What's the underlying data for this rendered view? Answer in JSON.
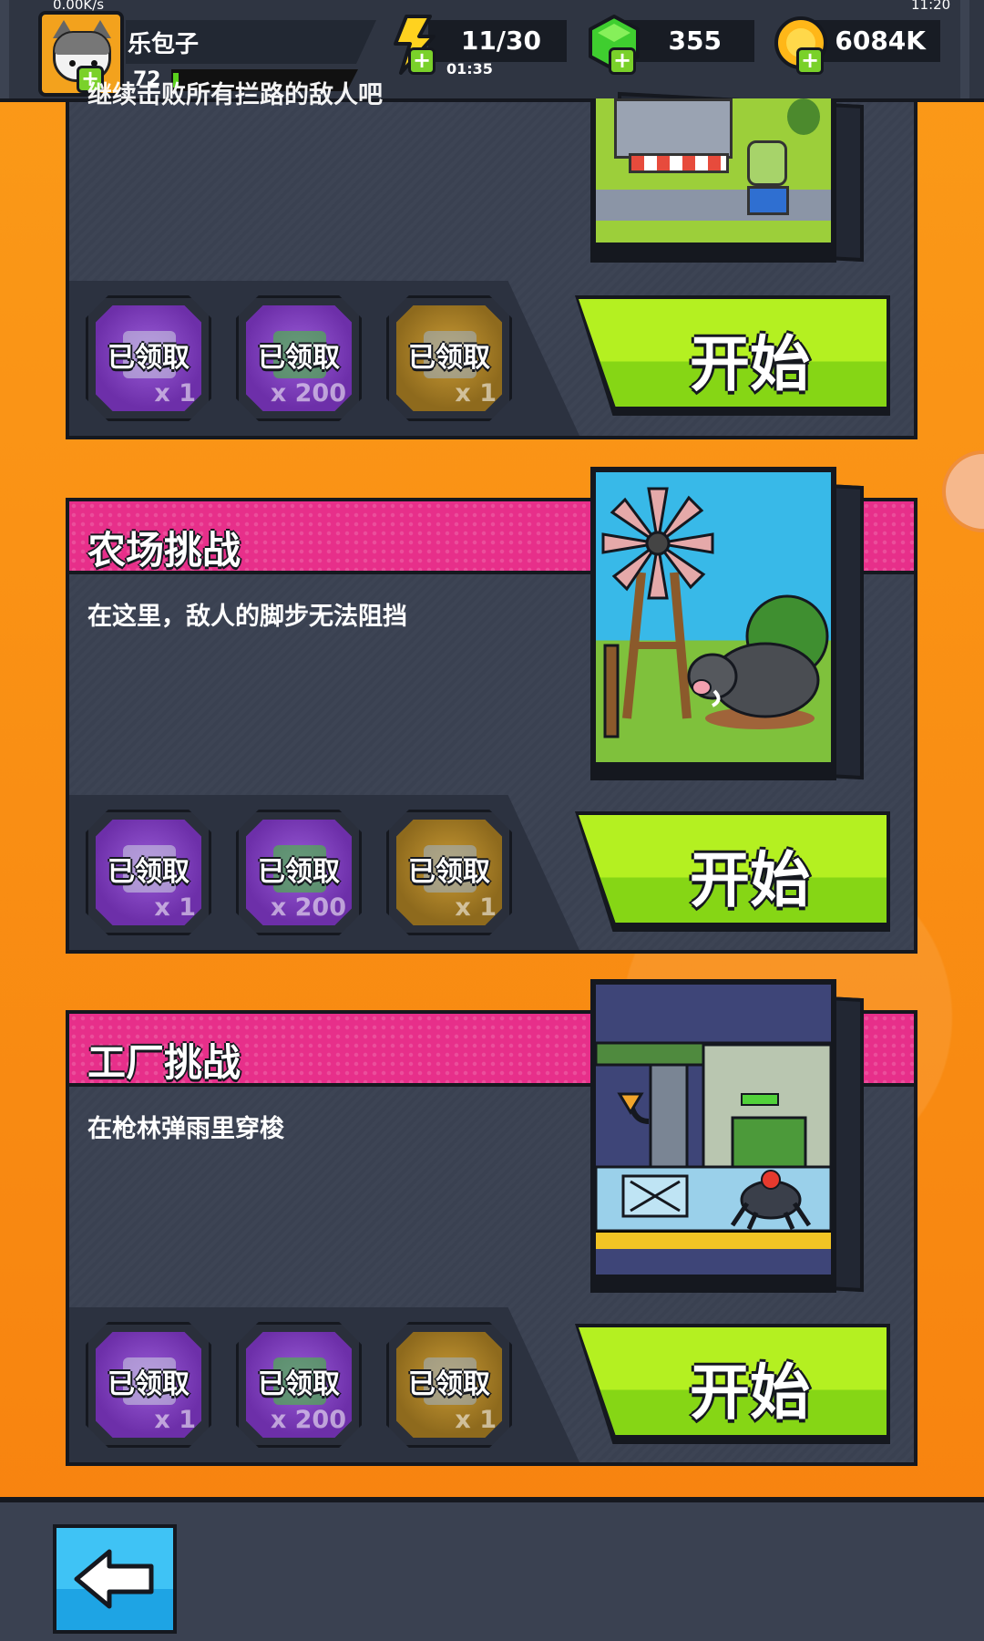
{
  "status_bar": {
    "left_fragment": "0.00K/s",
    "right_fragment": "11:20"
  },
  "player": {
    "name": "乐包子",
    "level": "72",
    "xp_progress": 0.03
  },
  "resources": {
    "energy": {
      "value": "11/30",
      "timer": "01:35",
      "icon": "lightning-icon"
    },
    "gems": {
      "value": "355",
      "icon": "green-gem-icon"
    },
    "coins": {
      "value": "6084K",
      "icon": "gold-coin-icon"
    }
  },
  "challenges": [
    {
      "title": "",
      "description": "继续击败所有拦路的敌人吧",
      "rewards": [
        {
          "label": "已领取",
          "qty": "x 1",
          "style": "purple",
          "icon": "map-icon"
        },
        {
          "label": "已领取",
          "qty": "x 200",
          "style": "purple",
          "icon": "green-gem-icon"
        },
        {
          "label": "已领取",
          "qty": "x 1",
          "style": "gold",
          "icon": "blueprint-icon"
        }
      ],
      "start_label": "开始",
      "art": "city-street-zombie-art"
    },
    {
      "title": "农场挑战",
      "description": "在这里，敌人的脚步无法阻挡",
      "rewards": [
        {
          "label": "已领取",
          "qty": "x 1",
          "style": "purple",
          "icon": "map-icon"
        },
        {
          "label": "已领取",
          "qty": "x 200",
          "style": "purple",
          "icon": "green-gem-icon"
        },
        {
          "label": "已领取",
          "qty": "x 1",
          "style": "gold",
          "icon": "blueprint-icon"
        }
      ],
      "start_label": "开始",
      "art": "farm-windmill-boar-art"
    },
    {
      "title": "工厂挑战",
      "description": "在枪林弹雨里穿梭",
      "rewards": [
        {
          "label": "已领取",
          "qty": "x 1",
          "style": "purple",
          "icon": "map-icon"
        },
        {
          "label": "已领取",
          "qty": "x 200",
          "style": "purple",
          "icon": "green-gem-icon"
        },
        {
          "label": "已领取",
          "qty": "x 1",
          "style": "gold",
          "icon": "blueprint-icon"
        }
      ],
      "start_label": "开始",
      "art": "factory-spider-robot-art"
    }
  ],
  "navigation": {
    "back_icon": "back-arrow-icon"
  },
  "colors": {
    "accent_pink": "#e72f8a",
    "start_green": "#9be21b",
    "background_orange": "#f98a14",
    "panel": "#3a4151",
    "back_blue": "#2bb4ee"
  }
}
